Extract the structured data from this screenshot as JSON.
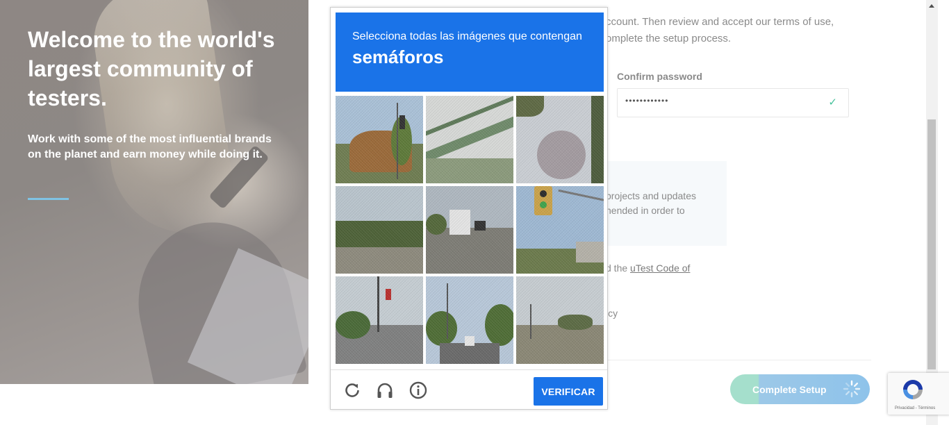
{
  "hero": {
    "title": "Welcome to the world's largest community of testers.",
    "subtitle": "Work with some of the most influential brands on the planet and earn money while doing it."
  },
  "form": {
    "intro": "...ccount. Then review and accept our terms of use, ...omplete the setup process.",
    "intro_line1": "ccount. Then review and accept our terms of use,",
    "intro_line2": "omplete the setup process.",
    "confirm_password_label": "Confirm password",
    "confirm_password_value": "••••••••••••",
    "note_line1": "projects and updates",
    "note_line2": "nended in order to",
    "code_prefix": "d the ",
    "code_link": "uTest Code of",
    "icy_text": "icy",
    "complete_setup_label": "Complete Setup"
  },
  "captcha": {
    "instruction": "Selecciona todas las imágenes que contengan",
    "target": "semáforos",
    "verify_label": "VERIFICAR",
    "tiles": [
      {
        "scene": "traffic-light-trees"
      },
      {
        "scene": "bridge"
      },
      {
        "scene": "palm-trees"
      },
      {
        "scene": "field"
      },
      {
        "scene": "highway-truck"
      },
      {
        "scene": "traffic-light-closeup"
      },
      {
        "scene": "intersection"
      },
      {
        "scene": "street-car"
      },
      {
        "scene": "rail-crossing"
      }
    ]
  },
  "recaptcha_badge": {
    "terms": "Privacidad - Términos"
  },
  "colors": {
    "captcha_blue": "#1a73e8",
    "accent_teal": "#46c19b",
    "hero_rule": "#7fc3e4"
  }
}
